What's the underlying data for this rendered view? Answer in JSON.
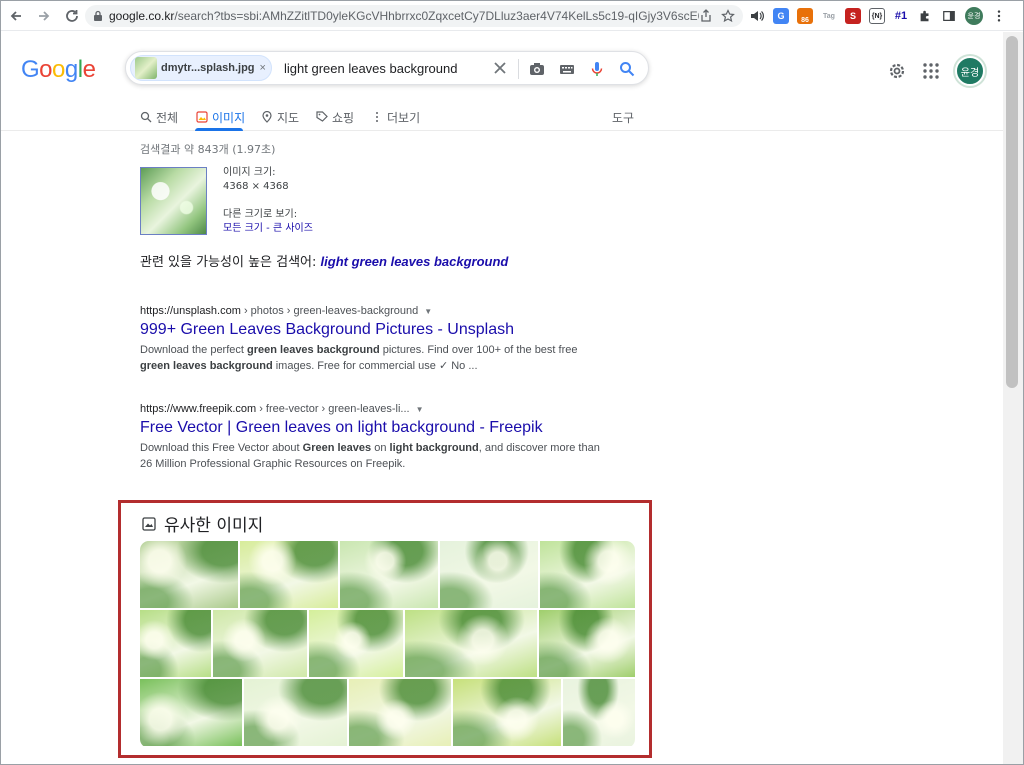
{
  "browser": {
    "url_main": "google.co.kr",
    "url_rest": "/search?tbs=sbi:AMhZZitlTD0yleKGcVHhbrrxc0ZqxcetCy7DLluz3aer4V74KelLs5c19-qIGjy3V6scE6LzHfZzog...",
    "extensions": [
      {
        "name": "volume-icon",
        "label": "",
        "color": "#5f6368"
      },
      {
        "name": "translate-ext",
        "label": "",
        "color": "#4285f4"
      },
      {
        "name": "badge-ext",
        "label": "86",
        "color": "#e8710a"
      },
      {
        "name": "tag-ext",
        "label": "Tag",
        "color": "#9aa0a6"
      },
      {
        "name": "s-ext",
        "label": "S",
        "color": "#c5221f"
      },
      {
        "name": "bracket-ext",
        "label": "{N}",
        "color": "#202124"
      },
      {
        "name": "rank-ext",
        "label": "#1",
        "color": "#1a0dab"
      }
    ],
    "profile_label": "윤경"
  },
  "search": {
    "chip_name": "dmytr...splash.jpg",
    "chip_close": "×",
    "query": "light green leaves background"
  },
  "header": {
    "avatar_label": "윤경"
  },
  "tabs": [
    {
      "label": "전체"
    },
    {
      "label": "이미지"
    },
    {
      "label": "지도"
    },
    {
      "label": "쇼핑"
    },
    {
      "label": "더보기"
    }
  ],
  "tools_label": "도구",
  "stats": "검색결과 약 843개 (1.97초)",
  "image_info": {
    "size_label": "이미지 크기:",
    "size_value": "4368 × 4368",
    "other_sizes_label": "다른 크기로 보기:",
    "all_sizes": "모든 크기",
    "dash": " - ",
    "large_size": "큰 사이즈"
  },
  "related": {
    "prefix": "관련 있을 가능성이 높은 검색어:",
    "term": "light green leaves background"
  },
  "results": [
    {
      "host": "https://unsplash.com",
      "path": " › photos › green-leaves-background",
      "title": "999+ Green Leaves Background Pictures - Unsplash",
      "snippet_parts": [
        {
          "t": "Download the perfect ",
          "b": false
        },
        {
          "t": "green leaves background",
          "b": true
        },
        {
          "t": " pictures. Find over 100+ of the best free ",
          "b": false
        },
        {
          "t": "green leaves background",
          "b": true
        },
        {
          "t": " images. Free for commercial use ✓ No ...",
          "b": false
        }
      ]
    },
    {
      "host": "https://www.freepik.com",
      "path": " › free-vector › green-leaves-li...",
      "title": "Free Vector | Green leaves on light background - Freepik",
      "snippet_parts": [
        {
          "t": "Download this Free Vector about ",
          "b": false
        },
        {
          "t": "Green leaves",
          "b": true
        },
        {
          "t": " on ",
          "b": false
        },
        {
          "t": "light background",
          "b": true
        },
        {
          "t": ", and discover more than 26 Million Professional Graphic Resources on Freepik.",
          "b": false
        }
      ]
    }
  ],
  "similar": {
    "title": "유사한 이미지",
    "rows": [
      [
        "#a9c98a",
        "#d7ec9a",
        "#c9e6b0",
        "#e5f2dc",
        "#bfe39a"
      ],
      [
        "#b6de86",
        "#cfe8a8",
        "#d4ef9a",
        "#bde084",
        "#9fce6c"
      ],
      [
        "#79c05b",
        "#e4f2d4",
        "#e7efb6",
        "#c6e07a",
        "#e9f3df"
      ]
    ]
  }
}
